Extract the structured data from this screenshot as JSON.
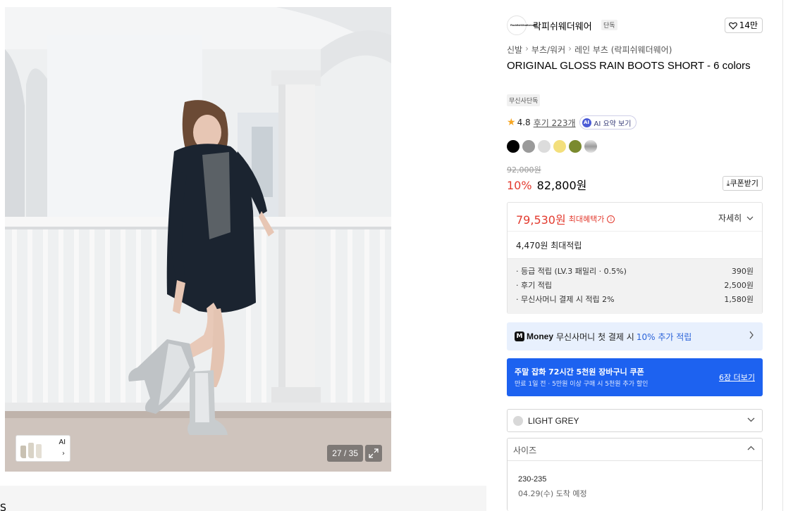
{
  "gallery": {
    "counter": "27 / 35",
    "thumb_ai_label": "AI",
    "thumb_arrow": "›"
  },
  "bottom_cut_text": "S",
  "brand": {
    "logo_text": "RockfishWeatherwear",
    "name": "락피쉬웨더웨어",
    "badge": "단독",
    "likes": "14만"
  },
  "breadcrumb": [
    "신발",
    "부츠/워커",
    "레인 부츠 (락피쉬웨더웨어)"
  ],
  "product": {
    "title": "ORIGINAL GLOSS RAIN BOOTS SHORT - 6 colors",
    "exclusive_tag": "무신사단독",
    "rating": "4.8",
    "reviews": "후기 223개",
    "ai_summary": "AI 요약 보기",
    "colors": [
      "#000000",
      "#9a9a9a",
      "#dcdcdc",
      "#f3df7c",
      "#7a8a2e",
      "#bfbfbf"
    ],
    "original_price": "92,000원",
    "discount": "10%",
    "price": "82,800원",
    "coupon_button": "쿠폰받기"
  },
  "benefit": {
    "max_price": "79,530원",
    "max_label": "최대혜택가",
    "detail_link": "자세히",
    "points_total": "4,470원 최대적립",
    "points": [
      {
        "label": "· 등급 적립 (LV.3 패밀리 · 0.5%)",
        "value": "390원"
      },
      {
        "label": "· 후기 적립",
        "value": "2,500원"
      },
      {
        "label": "· 무신사머니 결제 시 적립 2%",
        "value": "1,580원"
      }
    ]
  },
  "money_banner": {
    "icon": "M",
    "brand": "Money",
    "text": "무신사머니 첫 결제 시",
    "highlight": "10% 추가 적립"
  },
  "coupon_banner": {
    "title": "주말 잡화 72시간 5천원 장바구니 쿠폰",
    "subtitle": "만료 1일 전 · 5만원 이상 구매 시 5천원 추가 할인",
    "link": "6장 더보기"
  },
  "color_select": {
    "value": "LIGHT GREY",
    "dot_color": "#d8d8d8"
  },
  "size_select": {
    "label": "사이즈",
    "option": "230-235",
    "arrival": "04.29(수) 도착 예정"
  }
}
